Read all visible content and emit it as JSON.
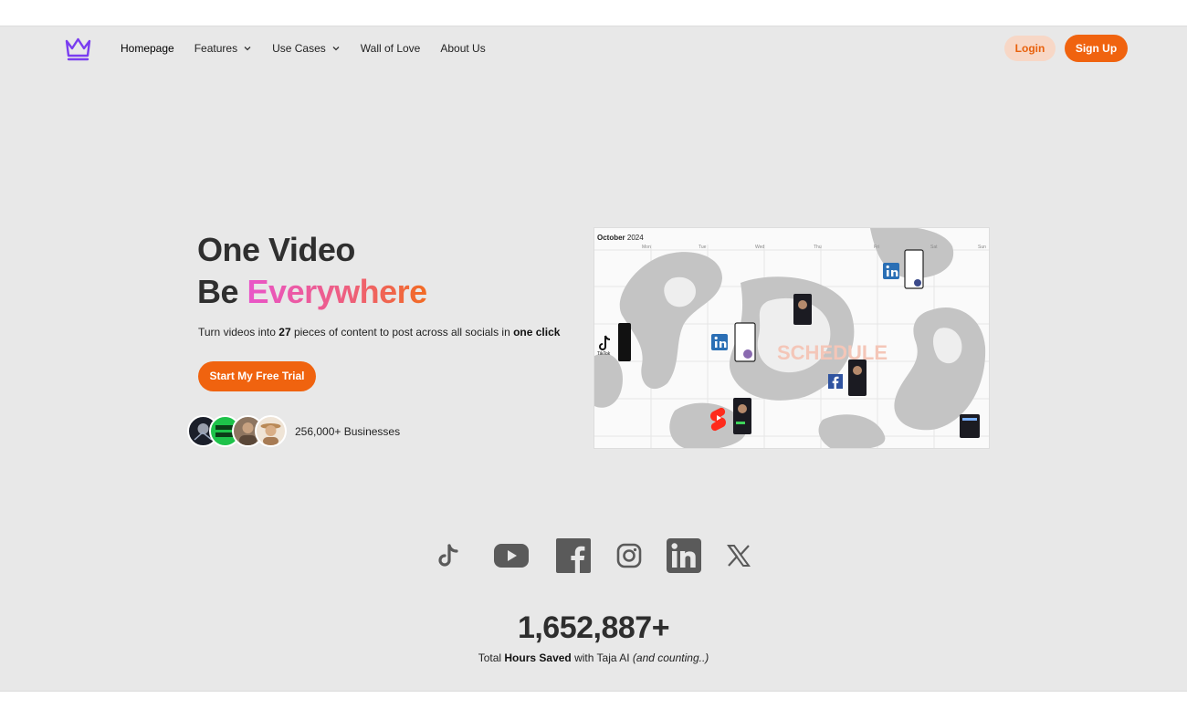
{
  "nav": {
    "logo": "crown-logo",
    "links": [
      {
        "label": "Homepage",
        "dropdown": false
      },
      {
        "label": "Features",
        "dropdown": true
      },
      {
        "label": "Use Cases",
        "dropdown": true
      },
      {
        "label": "Wall of Love",
        "dropdown": false
      },
      {
        "label": "About Us",
        "dropdown": false
      }
    ],
    "login_label": "Login",
    "signup_label": "Sign Up"
  },
  "hero": {
    "title_line1": "One Video",
    "title_line2_prefix": "Be ",
    "title_line2_highlight": "Everywhere",
    "subtitle_a": "Turn videos into ",
    "subtitle_b": "27",
    "subtitle_c": " pieces of content to post across all socials in ",
    "subtitle_d": "one click",
    "cta_label": "Start My Free Trial",
    "businesses_label": "256,000+ Businesses"
  },
  "calendar": {
    "month_bold": "October",
    "year": "2024",
    "days": [
      "Mon",
      "Tue",
      "Wed",
      "Thu",
      "Fri",
      "Sat",
      "Sun"
    ],
    "watermark": "SCHEDULE",
    "tiktok_label": "TikTok"
  },
  "socials": [
    "tiktok-icon",
    "youtube-icon",
    "facebook-icon",
    "instagram-icon",
    "linkedin-icon",
    "x-icon"
  ],
  "stats": {
    "count": "1,652,887+",
    "line_a": "Total ",
    "line_b": "Hours Saved",
    "line_c": " with Taja AI ",
    "line_d": "(and counting..)"
  },
  "colors": {
    "brand_orange": "#f0630f",
    "logo_purple": "#7a3df0",
    "background": "#e8e8e8"
  }
}
